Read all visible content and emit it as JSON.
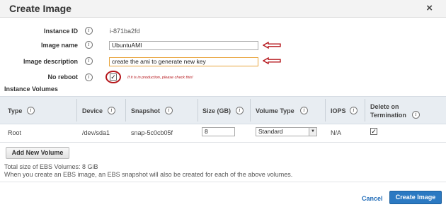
{
  "dialog": {
    "title": "Create Image",
    "close_glyph": "×"
  },
  "form": {
    "info_glyph": "i",
    "instance_id": {
      "label": "Instance ID",
      "value": "i-871ba2fd"
    },
    "image_name": {
      "label": "Image name",
      "value": "UbuntuAMI"
    },
    "image_description": {
      "label": "Image description",
      "value": "create the ami to generate new key"
    },
    "no_reboot": {
      "label": "No reboot",
      "checked": true,
      "check_glyph": "✓",
      "annotation": "If it is in production, please check this!"
    }
  },
  "annotation_colors": {
    "red": "#b5161b",
    "highlight": "#e8a43c"
  },
  "volumes": {
    "section_title": "Instance Volumes",
    "headers": {
      "type": "Type",
      "device": "Device",
      "snapshot": "Snapshot",
      "size": "Size (GB)",
      "volume_type": "Volume Type",
      "iops": "IOPS",
      "delete_line1": "Delete on",
      "delete_line2": "Termination"
    },
    "rows": [
      {
        "type": "Root",
        "device": "/dev/sda1",
        "snapshot": "snap-5c0cb05f",
        "size": "8",
        "volume_type": "Standard",
        "iops": "N/A",
        "delete_on_termination": true,
        "check_glyph": "✓"
      }
    ],
    "add_button": "Add New Volume"
  },
  "summary": {
    "total_size": "Total size of EBS Volumes: 8 GiB",
    "note": "When you create an EBS image, an EBS snapshot will also be created for each of the above volumes."
  },
  "footer": {
    "cancel": "Cancel",
    "create": "Create Image"
  },
  "colors": {
    "primary_button": "#2b79c2",
    "link": "#1f6bb8",
    "table_header_bg": "#e8edf2"
  }
}
